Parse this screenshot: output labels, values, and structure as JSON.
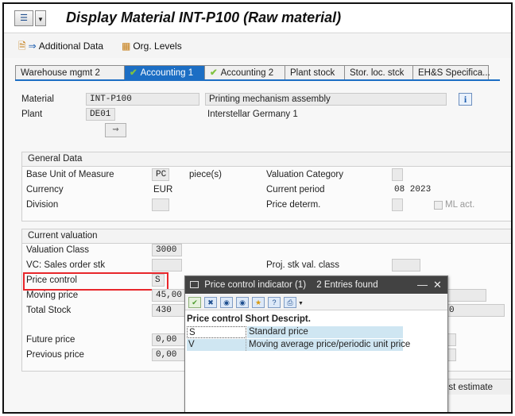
{
  "window": {
    "title": "Display Material INT-P100 (Raw material)",
    "menu_icon": "sap-menu-icon"
  },
  "toolbar": {
    "additional_data": "Additional Data",
    "org_levels": "Org. Levels"
  },
  "tabs": [
    {
      "label": "Warehouse mgmt 2",
      "checked": false,
      "active": false
    },
    {
      "label": "Accounting 1",
      "checked": true,
      "active": true
    },
    {
      "label": "Accounting 2",
      "checked": true,
      "active": false
    },
    {
      "label": "Plant stock",
      "checked": false,
      "active": false
    },
    {
      "label": "Stor. loc. stck",
      "checked": false,
      "active": false
    },
    {
      "label": "EH&S Specifica...",
      "checked": false,
      "active": false
    }
  ],
  "header": {
    "material_label": "Material",
    "material_value": "INT-P100",
    "material_desc": "Printing mechanism assembly",
    "plant_label": "Plant",
    "plant_value": "DE01",
    "plant_desc": "Interstellar Germany 1"
  },
  "general": {
    "title": "General Data",
    "base_uom_label": "Base Unit of Measure",
    "base_uom_value": "PC",
    "base_uom_text": "piece(s)",
    "currency_label": "Currency",
    "currency_value": "EUR",
    "division_label": "Division",
    "valuation_category_label": "Valuation Category",
    "current_period_label": "Current period",
    "current_period_value": "08 2023",
    "price_determ_label": "Price determ.",
    "ml_act_label": "ML act."
  },
  "valuation": {
    "title": "Current valuation",
    "valuation_class_label": "Valuation Class",
    "valuation_class_value": "3000",
    "vc_sales_label": "VC: Sales order stk",
    "proj_stk_label": "Proj. stk val. class",
    "price_control_label": "Price control",
    "price_control_value": "S",
    "moving_price_label": "Moving price",
    "moving_price_value": "45,00",
    "total_stock_label": "Total Stock",
    "total_stock_value": "430",
    "future_price_label": "Future price",
    "future_price_value": "0,00",
    "previous_price_label": "Previous price",
    "previous_price_value": "0,00",
    "right_partial": "0"
  },
  "popup": {
    "title": "Price control indicator (1)",
    "entries": "2 Entries found",
    "col1": "Price control",
    "col2": "Short Descript.",
    "rows": [
      {
        "code": "S",
        "desc": "Standard price"
      },
      {
        "code": "V",
        "desc": "Moving average price/periodic unit price"
      }
    ]
  },
  "footer": {
    "cost_estimate": "ost estimate"
  }
}
